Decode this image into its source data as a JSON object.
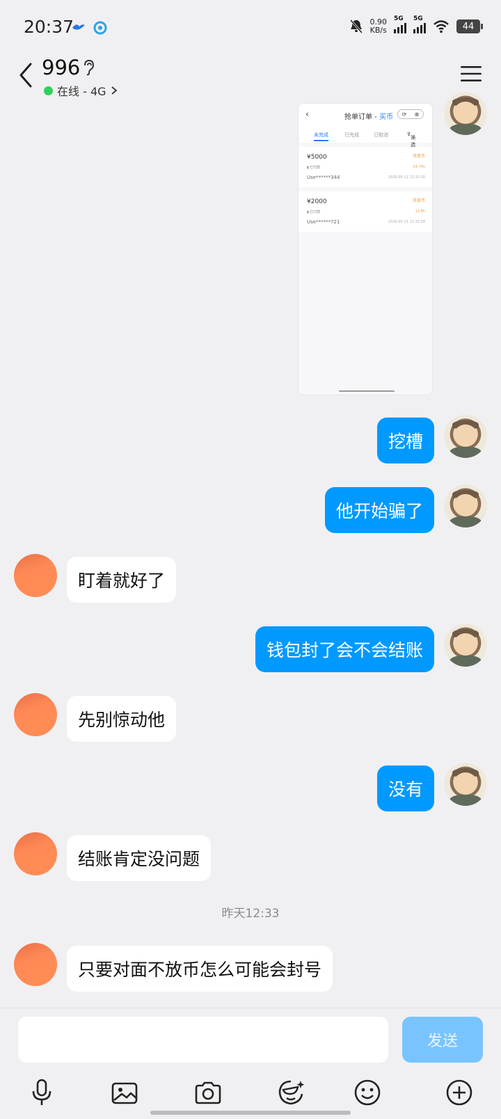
{
  "status_bar": {
    "time": "20:37",
    "net_speed_value": "0.90",
    "net_speed_unit": "KB/s",
    "sim1": "5G",
    "sim2": "5G",
    "battery": "44"
  },
  "header": {
    "title": "996",
    "presence": "在线 - 4G",
    "presence_color": "#2fd15b"
  },
  "shared_screenshot": {
    "title_main": "抢单订单 - ",
    "title_accent": "买币",
    "tabs": [
      "未完成",
      "已完成",
      "已取消"
    ],
    "filter_label": "筛选",
    "orders": [
      {
        "amount": "¥5000",
        "status": "待放币",
        "sub_left": "▮ 已付款",
        "sub_right": "14.74h",
        "user": "Use******344",
        "timestamp": "2026-05-11 12:32:20"
      },
      {
        "amount": "¥2000",
        "status": "待放币",
        "sub_left": "▮ 已付款",
        "sub_right": "13.8h",
        "user": "Use******721",
        "timestamp": "2026-05-11 12:31:58"
      }
    ]
  },
  "messages": [
    {
      "side": "me",
      "text": "挖槽"
    },
    {
      "side": "me",
      "text": "他开始骗了"
    },
    {
      "side": "other",
      "text": "盯着就好了"
    },
    {
      "side": "me",
      "text": "钱包封了会不会结账"
    },
    {
      "side": "other",
      "text": "先别惊动他"
    },
    {
      "side": "me",
      "text": "没有"
    },
    {
      "side": "other",
      "text": "结账肯定没问题"
    },
    {
      "side": "other",
      "text": "只要对面不放币怎么可能会封号"
    }
  ],
  "timestamp_divider": "昨天12:33",
  "composer": {
    "input_value": "",
    "send_label": "发送"
  },
  "toolbar_icons": [
    "microphone-icon",
    "image-icon",
    "camera-icon",
    "sticker-icon",
    "emoji-icon",
    "plus-icon"
  ],
  "colors": {
    "accent": "#0099ff",
    "background": "#f0f0f3",
    "send_disabled": "#79c4ff"
  }
}
